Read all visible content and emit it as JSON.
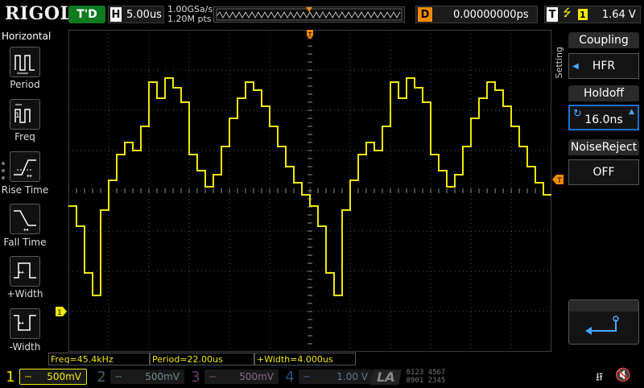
{
  "brand": "RIGOL",
  "run_status": "T'D",
  "timebase": {
    "label": "H",
    "value": "5.00us"
  },
  "sample": {
    "rate": "1.00GSa/s",
    "points": "1.20M pts"
  },
  "delay": {
    "label": "D",
    "value": "0.00000000ps"
  },
  "trigger": {
    "label": "T",
    "edge_icon": "rising-edge-icon",
    "source": "1",
    "level": "1.64 V"
  },
  "left_menu": {
    "title": "Horizontal",
    "items": [
      {
        "label": "Period",
        "icon": "period-icon"
      },
      {
        "label": "Freq",
        "icon": "frequency-icon"
      },
      {
        "label": "Rise Time",
        "icon": "rise-time-icon"
      },
      {
        "label": "Fall Time",
        "icon": "fall-time-icon"
      },
      {
        "label": "+Width",
        "icon": "positive-width-icon"
      },
      {
        "label": "-Width",
        "icon": "negative-width-icon"
      }
    ]
  },
  "measurements": {
    "freq": "Freq=45.4kHz",
    "period": "Period=22.00us",
    "pwidth": "+Width=4.000us"
  },
  "right_menu": {
    "setting_label": "Setting",
    "coupling": {
      "title": "Coupling",
      "value": "HFR"
    },
    "holdoff": {
      "title": "Holdoff",
      "value": "16.0ns"
    },
    "noise_reject": {
      "title": "NoiseReject",
      "value": "OFF"
    }
  },
  "channels": [
    {
      "num": "1",
      "value": "500mV",
      "color": "#f0e800",
      "active": true
    },
    {
      "num": "2",
      "value": "500mV",
      "color": "#00c8d8",
      "active": false
    },
    {
      "num": "3",
      "value": "500mV",
      "color": "#e040e0",
      "active": false
    },
    {
      "num": "4",
      "value": "1.00 V",
      "color": "#2a7ae0",
      "active": false
    }
  ],
  "la": {
    "label": "LA",
    "row1": "0123 4567",
    "row2": "8901 2345"
  },
  "colors": {
    "ch1": "#f0e800",
    "trigger": "#f08a00",
    "run": "#0f7a20",
    "accent": "#1e6fd0"
  }
}
